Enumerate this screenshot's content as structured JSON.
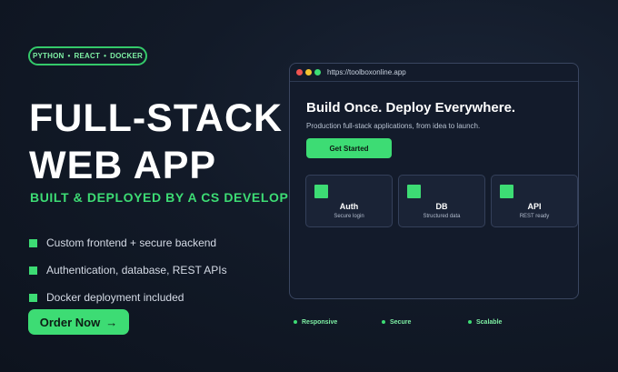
{
  "tags": [
    "PYTHON",
    "REACT",
    "DOCKER"
  ],
  "tag_separator": "•",
  "hero": {
    "title_line1": "FULL-STACK",
    "title_line2": "WEB APP",
    "subtitle": "BUILT & DEPLOYED BY A CS DEVELOPER"
  },
  "features": [
    "Custom frontend + secure backend",
    "Authentication, database, REST APIs",
    "Docker deployment included"
  ],
  "order_button": {
    "label": "Order Now",
    "arrow": "→"
  },
  "browser": {
    "url": "https://toolboxonline.app",
    "heading": "Build Once. Deploy Everywhere.",
    "description": "Production full-stack applications, from idea to launch.",
    "cta_label": "Get Started",
    "cards": [
      {
        "title": "Auth",
        "subtitle": "Secure login"
      },
      {
        "title": "DB",
        "subtitle": "Structured data"
      },
      {
        "title": "API",
        "subtitle": "REST ready"
      }
    ]
  },
  "badges": [
    "Responsive",
    "Secure",
    "Scalable"
  ],
  "colors": {
    "accent": "#3ddc74",
    "background": "#121a28",
    "card": "#1a2336"
  }
}
